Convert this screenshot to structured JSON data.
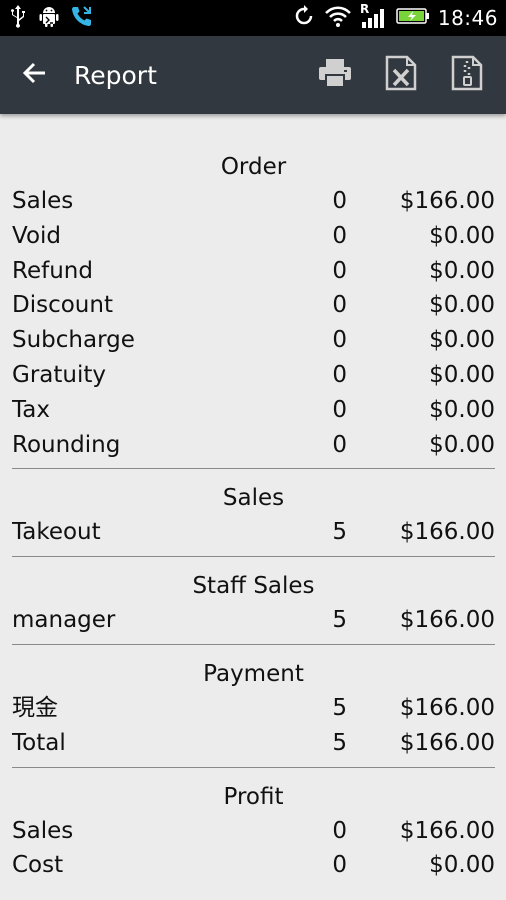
{
  "status_bar": {
    "time": "18:46",
    "icons": [
      "usb-icon",
      "android-debug-icon",
      "call-forward-icon",
      "sync-icon",
      "wifi-icon",
      "signal-icon",
      "battery-charging-icon"
    ],
    "roaming_indicator": "R"
  },
  "action_bar": {
    "title": "Report",
    "actions": [
      "print-icon",
      "excel-export-icon",
      "zip-file-icon"
    ]
  },
  "sections": [
    {
      "title": "Order",
      "rows": [
        {
          "name": "Sales",
          "count": "0",
          "amount": "$166.00"
        },
        {
          "name": "Void",
          "count": "0",
          "amount": "$0.00"
        },
        {
          "name": "Refund",
          "count": "0",
          "amount": "$0.00"
        },
        {
          "name": "Discount",
          "count": "0",
          "amount": "$0.00"
        },
        {
          "name": "Subcharge",
          "count": "0",
          "amount": "$0.00"
        },
        {
          "name": "Gratuity",
          "count": "0",
          "amount": "$0.00"
        },
        {
          "name": "Tax",
          "count": "0",
          "amount": "$0.00"
        },
        {
          "name": "Rounding",
          "count": "0",
          "amount": "$0.00"
        }
      ]
    },
    {
      "title": "Sales",
      "rows": [
        {
          "name": "Takeout",
          "count": "5",
          "amount": "$166.00"
        }
      ]
    },
    {
      "title": "Staff Sales",
      "rows": [
        {
          "name": "manager",
          "count": "5",
          "amount": "$166.00"
        }
      ]
    },
    {
      "title": "Payment",
      "rows": [
        {
          "name": "現金",
          "count": "5",
          "amount": "$166.00"
        },
        {
          "name": "Total",
          "count": "5",
          "amount": "$166.00"
        }
      ]
    },
    {
      "title": "Profit",
      "rows": [
        {
          "name": "Sales",
          "count": "0",
          "amount": "$166.00"
        },
        {
          "name": "Cost",
          "count": "0",
          "amount": "$0.00"
        }
      ]
    }
  ]
}
